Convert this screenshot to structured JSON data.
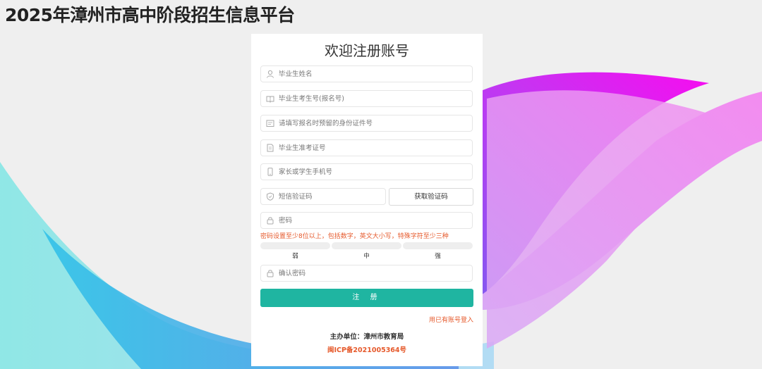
{
  "site": {
    "title": "2025年漳州市高中阶段招生信息平台"
  },
  "form": {
    "title": "欢迎注册账号",
    "fields": {
      "name": {
        "placeholder": "毕业生姓名",
        "icon": "user-icon"
      },
      "exam_no": {
        "placeholder": "毕业生考生号(报名号)",
        "icon": "book-icon"
      },
      "id_no": {
        "placeholder": "请填写报名时预留的身份证件号",
        "icon": "id-card-icon"
      },
      "admission_no": {
        "placeholder": "毕业生准考证号",
        "icon": "document-icon"
      },
      "phone": {
        "placeholder": "家长或学生手机号",
        "icon": "phone-icon"
      },
      "sms_code": {
        "placeholder": "短信验证码",
        "icon": "shield-icon"
      },
      "password": {
        "placeholder": "密码",
        "icon": "lock-icon"
      },
      "confirm_password": {
        "placeholder": "确认密码",
        "icon": "lock-icon"
      }
    },
    "get_code_button": "获取验证码",
    "password_hint": "密码设置至少8位以上，包括数字，英文大小写，特殊字符至少三种",
    "strength_labels": [
      "弱",
      "中",
      "强"
    ],
    "submit_button": "注 册",
    "login_link": "用已有账号登入"
  },
  "footer": {
    "sponsor": "主办单位：漳州市教育局",
    "icp": "闽ICP备2021005364号"
  },
  "colors": {
    "accent": "#1fb5a1",
    "warning_text": "#e65a2c",
    "background": "#efefef"
  }
}
